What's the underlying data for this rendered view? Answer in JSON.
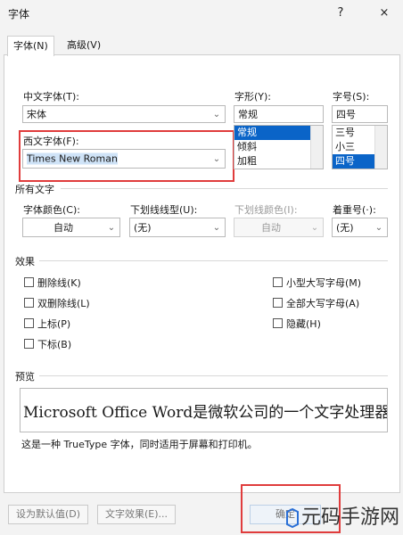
{
  "window": {
    "title": "字体",
    "help": "?",
    "close": "×"
  },
  "tabs": [
    {
      "label": "字体(N)"
    },
    {
      "label": "高级(V)"
    }
  ],
  "fonts": {
    "chinese_label": "中文字体(T):",
    "chinese_value": "宋体",
    "western_label": "西文字体(F):",
    "western_value": "Times New Roman",
    "style_label": "字形(Y):",
    "style_value": "常规",
    "style_options": [
      "常规",
      "倾斜",
      "加粗"
    ],
    "size_label": "字号(S):",
    "size_value": "四号",
    "size_options": [
      "三号",
      "小三",
      "四号"
    ]
  },
  "all_text": {
    "section": "所有文字",
    "color_label": "字体颜色(C):",
    "color_value": "自动",
    "underline_label": "下划线线型(U):",
    "underline_value": "(无)",
    "underline_color_label": "下划线颜色(I):",
    "underline_color_value": "自动",
    "emphasis_label": "着重号(·):",
    "emphasis_value": "(无)"
  },
  "effects": {
    "section": "效果",
    "left": [
      "删除线(K)",
      "双删除线(L)",
      "上标(P)",
      "下标(B)"
    ],
    "right": [
      "小型大写字母(M)",
      "全部大写字母(A)",
      "隐藏(H)"
    ]
  },
  "preview": {
    "section": "预览",
    "text": "Microsoft Office Word是微软公司的一个文字处理器应",
    "note": "这是一种 TrueType 字体，同时适用于屏幕和打印机。"
  },
  "buttons": {
    "set_default": "设为默认值(D)",
    "text_effects": "文字效果(E)...",
    "ok": "确定"
  },
  "watermark": "元码手游网",
  "colors": {
    "highlight": "#0a64c8",
    "red_box": "#e03c3c"
  }
}
